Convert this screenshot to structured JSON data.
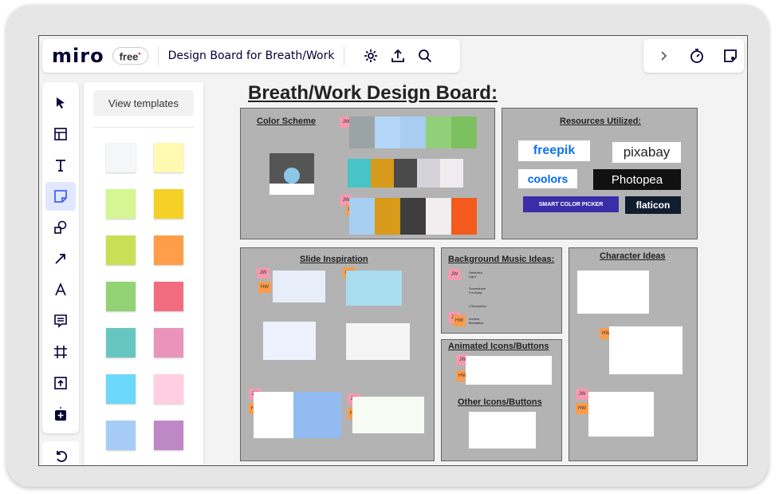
{
  "app": {
    "logo": "miro",
    "plan": "free",
    "plan_mark": "•",
    "board_title": "Design Board for Breath/Work"
  },
  "panel": {
    "view_templates": "View templates"
  },
  "sticky_colors": [
    "#f5f6f8",
    "#fff9b1",
    "#d5f692",
    "#f5d128",
    "#c9df56",
    "#ff9d48",
    "#93d275",
    "#f16c7f",
    "#67c6c0",
    "#ea94bb",
    "#6cd8fa",
    "#ffcee0",
    "#a6ccf5",
    "#be88c7"
  ],
  "board": {
    "heading": "Breath/Work Design Board:",
    "color_scheme": {
      "title": "Color Scheme",
      "row1": [
        "#9aa3a6",
        "#b3d6f6",
        "#a9cdf0",
        "#92cf79",
        "#7cc061"
      ],
      "row2": [
        "#48c4c8",
        "#d89a1a",
        "#4a4a4a",
        "#d4d2da",
        "#f0ebee"
      ],
      "row3": [
        "#a8cff2",
        "#d89a1a",
        "#3e3e3e",
        "#f2eef0",
        "#f45a1c"
      ]
    },
    "resources": {
      "title": "Resources Utilized:",
      "logos": {
        "freepik": "freepik",
        "pixabay": "pixabay",
        "coolors": "coolors",
        "photopea": "Photopea",
        "smart_color_picker": "SMART COLOR PICKER",
        "flaticon": "flaticon"
      }
    },
    "slide_inspiration": {
      "title": "Slide  Inspiration"
    },
    "music": {
      "title": "Background Music Ideas:",
      "items": [
        "Reflected Light",
        "Somewhere For Away",
        "I Remember",
        "Ancient Meditation"
      ]
    },
    "animated_icons": {
      "title": "Animated Icons/Buttons"
    },
    "other_icons": {
      "title": "Other Icons/Buttons"
    },
    "character_ideas": {
      "title": "Character Ideas"
    },
    "sticky_labels": {
      "jw": "JW",
      "hw": "HW"
    }
  }
}
